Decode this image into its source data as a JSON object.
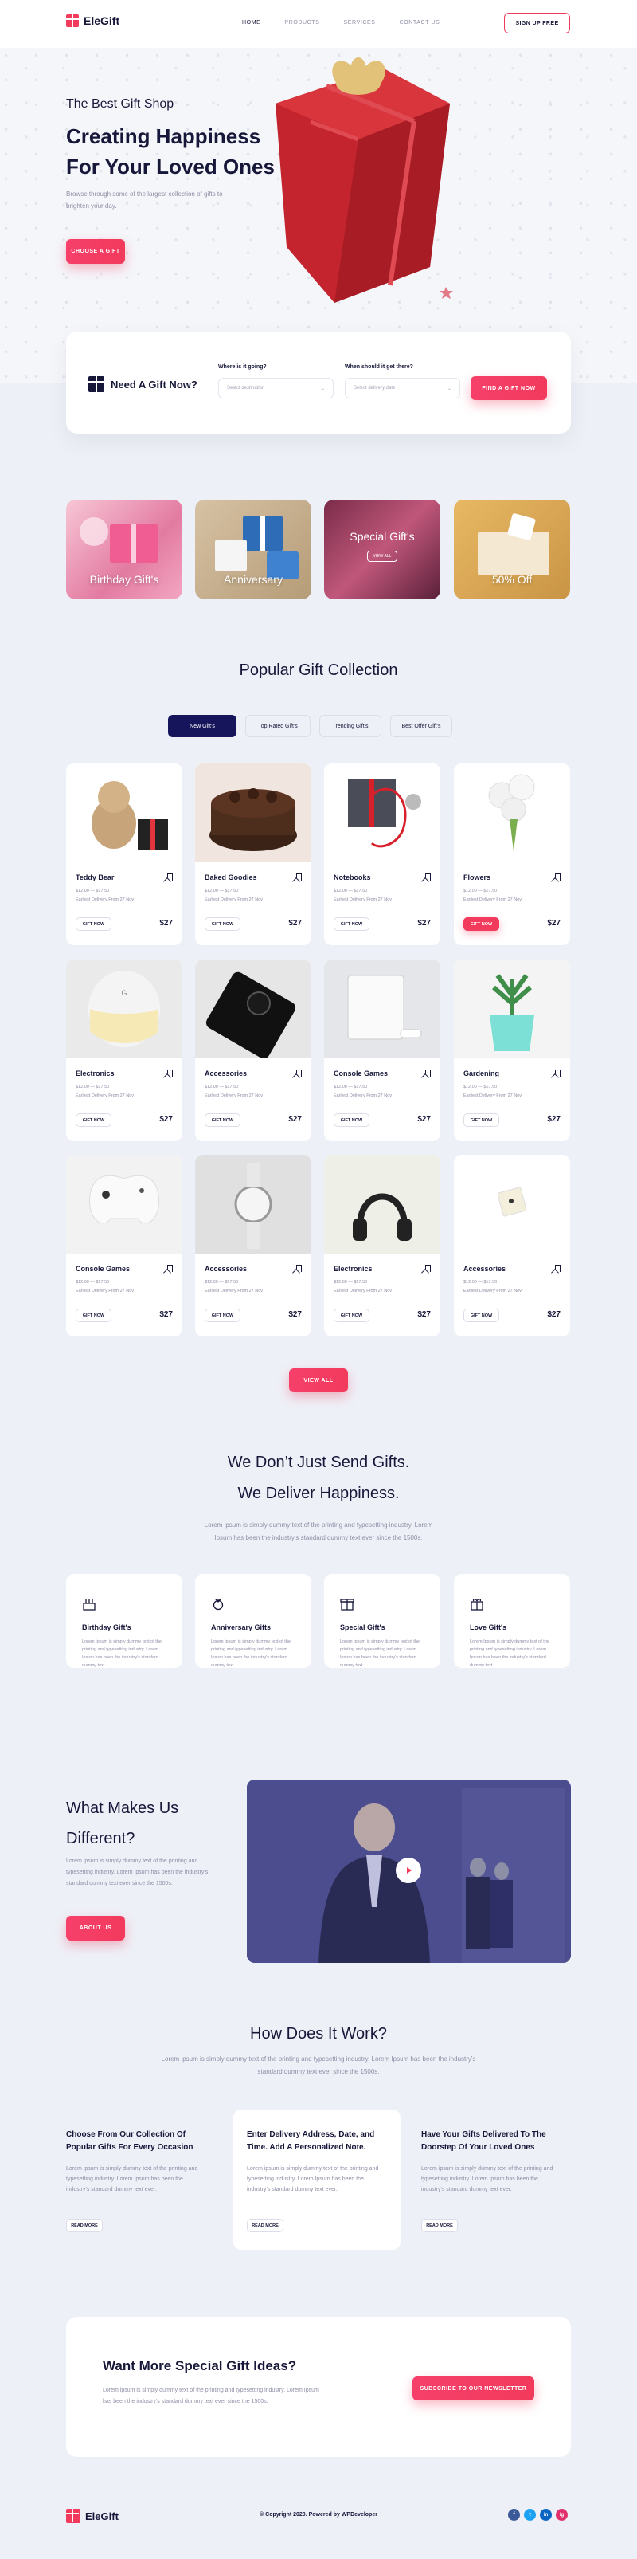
{
  "header": {
    "brand": "EleGift",
    "nav": [
      "HOME",
      "PRODUCTS",
      "SERVICES",
      "CONTACT US"
    ],
    "signup": "SIGN UP FREE"
  },
  "hero": {
    "subtitle": "The Best Gift Shop",
    "title_line1": "Creating Happiness",
    "title_line2": "For Your Loved Ones",
    "description": "Browse through some of the largest collection of gifts to brighten your day.",
    "cta": "CHOOSE A GIFT"
  },
  "search": {
    "heading": "Need A Gift Now?",
    "where_label": "Where is it going?",
    "where_placeholder": "Select destination",
    "when_label": "When should it get there?",
    "when_placeholder": "Select delivery date",
    "button": "FIND A GIFT NOW"
  },
  "categories": [
    {
      "label": "Birthday Gift's"
    },
    {
      "label": "Anniversary"
    },
    {
      "label": "Special Gift's",
      "sub": "VIEW ALL"
    },
    {
      "label": "50% Off"
    }
  ],
  "collection": {
    "title": "Popular Gift Collection",
    "tabs": [
      "New Gift's",
      "Top Rated Gift's",
      "Trending Gift's",
      "Best Offer Gift's"
    ],
    "view_all": "VIEW ALL",
    "products": [
      {
        "name": "Teddy Bear",
        "price_old": "$12.00 — $17.50",
        "delivery": "Earliest Delivery From 27 Nov",
        "button": "GIFT NOW",
        "price": "$27"
      },
      {
        "name": "Baked Goodies",
        "price_old": "$12.00 — $17.50",
        "delivery": "Earliest Delivery From 27 Nov",
        "button": "GIFT NOW",
        "price": "$27"
      },
      {
        "name": "Notebooks",
        "price_old": "$12.00 — $17.50",
        "delivery": "Earliest Delivery From 27 Nov",
        "button": "GIFT NOW",
        "price": "$27"
      },
      {
        "name": "Flowers",
        "price_old": "$12.00 — $17.50",
        "delivery": "Earliest Delivery From 27 Nov",
        "button": "GIFT NOW",
        "price": "$27"
      },
      {
        "name": "Electronics",
        "price_old": "$12.00 — $17.50",
        "delivery": "Earliest Delivery From 27 Nov",
        "button": "GIFT NOW",
        "price": "$27"
      },
      {
        "name": "Accessories",
        "price_old": "$12.00 — $17.50",
        "delivery": "Earliest Delivery From 27 Nov",
        "button": "GIFT NOW",
        "price": "$27"
      },
      {
        "name": "Console Games",
        "price_old": "$12.00 — $17.50",
        "delivery": "Earliest Delivery From 27 Nov",
        "button": "GIFT NOW",
        "price": "$27"
      },
      {
        "name": "Gardening",
        "price_old": "$12.00 — $17.50",
        "delivery": "Earliest Delivery From 27 Nov",
        "button": "GIFT NOW",
        "price": "$27"
      },
      {
        "name": "Console Games",
        "price_old": "$12.00 — $17.50",
        "delivery": "Earliest Delivery From 27 Nov",
        "button": "GIFT NOW",
        "price": "$27"
      },
      {
        "name": "Accessories",
        "price_old": "$12.00 — $17.50",
        "delivery": "Earliest Delivery From 27 Nov",
        "button": "GIFT NOW",
        "price": "$27"
      },
      {
        "name": "Electronics",
        "price_old": "$12.00 — $17.50",
        "delivery": "Earliest Delivery From 27 Nov",
        "button": "GIFT NOW",
        "price": "$27"
      },
      {
        "name": "Accessories",
        "price_old": "$12.00 — $17.50",
        "delivery": "Earliest Delivery From 27 Nov",
        "button": "GIFT NOW",
        "price": "$27"
      }
    ]
  },
  "happiness": {
    "title_line1": "We Don’t Just Send Gifts.",
    "title_line2": "We Deliver Happiness.",
    "description": "Lorem ipsum is simply dummy text of the printing and typesetting industry. Lorem Ipsum has been the industry's standard dummy text ever since the 1500s.",
    "services": [
      {
        "title": "Birthday Gift's",
        "icon": "cake-icon",
        "desc": "Lorem Ipsum is simply dummy text of the printing and typesetting industry. Lorem Ipsum has been the industry's standard dummy text."
      },
      {
        "title": "Anniversary Gifts",
        "icon": "ring-icon",
        "desc": "Lorem Ipsum is simply dummy text of the printing and typesetting industry. Lorem Ipsum has been the industry's standard dummy text."
      },
      {
        "title": "Special Gift's",
        "icon": "gift-icon",
        "desc": "Lorem Ipsum is simply dummy text of the printing and typesetting industry. Lorem Ipsum has been the industry's standard dummy text."
      },
      {
        "title": "Love Gift's",
        "icon": "gift-heart-icon",
        "desc": "Lorem Ipsum is simply dummy text of the printing and typesetting industry. Lorem Ipsum has been the industry's standard dummy text."
      }
    ]
  },
  "about": {
    "title_line1": "What Makes Us",
    "title_line2": "Different?",
    "description": "Lorem ipsum is simply dummy text of the printing and typesetting industry. Lorem Ipsum has been the industry's standard dummy text ever since the 1500s.",
    "button": "ABOUT US"
  },
  "how": {
    "title": "How Does It Work?",
    "description": "Lorem ipsum is simply dummy text of the printing and typesetting industry. Lorem Ipsum has been the industry's standard dummy text ever since the 1500s.",
    "steps": [
      {
        "title": "Choose From Our Collection Of Popular Gifts For Every Occasion",
        "desc": "Lorem ipsum is simply dummy text of the printing and typesetting industry. Lorem Ipsum has been the industry's standard dummy text ever.",
        "button": "READ MORE"
      },
      {
        "title": "Enter Delivery Address, Date, and Time. Add A Personalized Note.",
        "desc": "Lorem ipsum is simply dummy text of the printing and typesetting industry. Lorem Ipsum has been the industry's standard dummy text ever.",
        "button": "READ MORE"
      },
      {
        "title": "Have Your Gifts Delivered To The Doorstep Of Your Loved Ones",
        "desc": "Lorem ipsum is simply dummy text of the printing and typesetting industry. Lorem Ipsum has been the industry's standard dummy text ever.",
        "button": "READ MORE"
      }
    ]
  },
  "newsletter": {
    "title": "Want More Special Gift Ideas?",
    "description": "Lorem ipsum is simply dummy text of the printing and typesetting industry. Lorem Ipsum has been the industry's standard dummy text ever since the 1500s.",
    "button": "SUBSCRIBE TO OUR NEWSLETTER"
  },
  "footer": {
    "brand": "EleGift",
    "copyright": "© Copyright 2020. Powered by WPDeveloper",
    "social": [
      "f",
      "t",
      "in",
      "ig"
    ]
  },
  "colors": {
    "accent": "#f23a5c",
    "navy": "#16155c",
    "background": "#eef0f7"
  }
}
